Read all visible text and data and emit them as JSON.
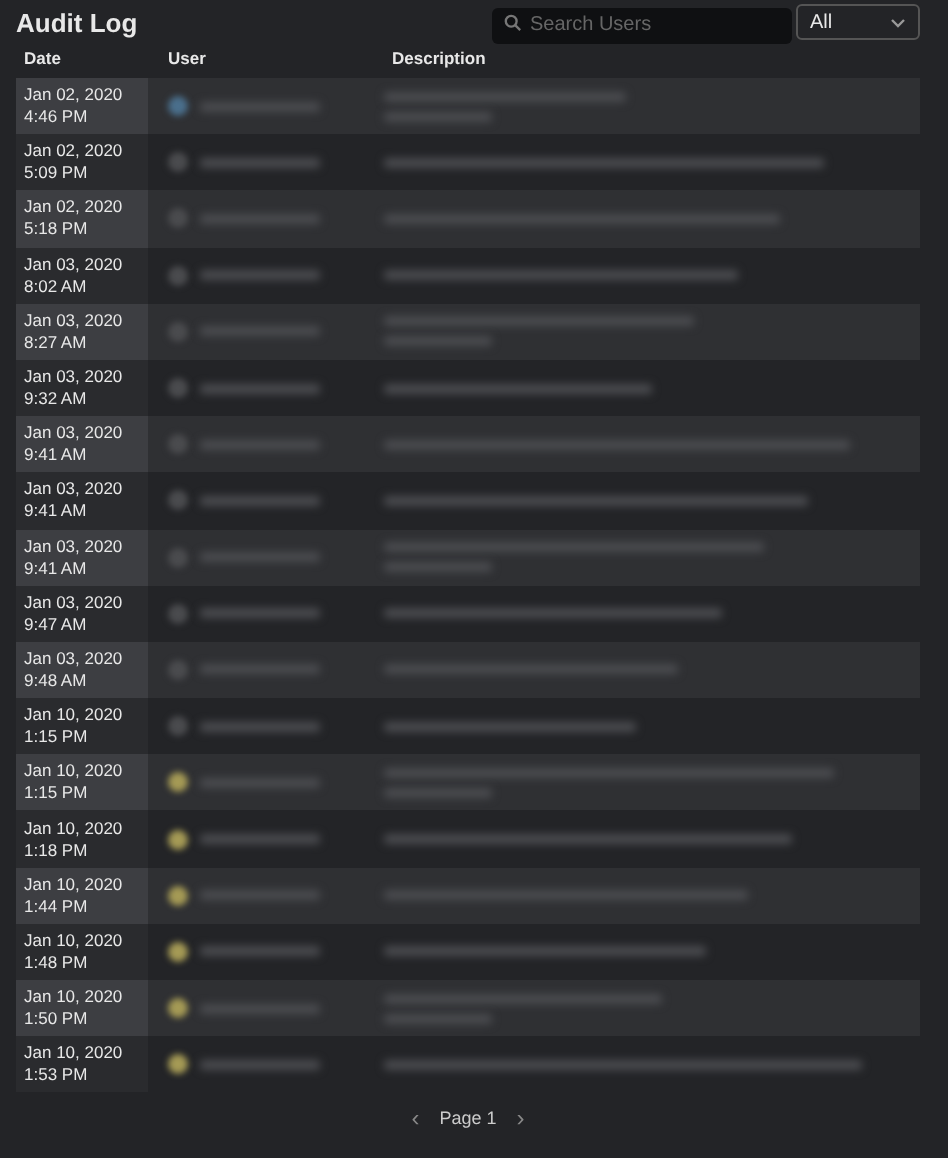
{
  "header": {
    "title": "Audit Log",
    "search": {
      "placeholder": "Search Users"
    },
    "filter": {
      "value": "All"
    }
  },
  "table": {
    "columns": [
      "Date",
      "User",
      "Description"
    ],
    "rows": [
      {
        "date": "Jan 02, 2020",
        "time": "4:46 PM",
        "color": "#4a6f8c"
      },
      {
        "date": "Jan 02, 2020",
        "time": "5:09 PM",
        "color": "#4a4b4e"
      },
      {
        "date": "Jan 02, 2020",
        "time": "5:18 PM",
        "color": "#4a4b4e"
      },
      {
        "date": "Jan 03, 2020",
        "time": "8:02 AM",
        "color": "#4a4b4e"
      },
      {
        "date": "Jan 03, 2020",
        "time": "8:27 AM",
        "color": "#4a4b4e"
      },
      {
        "date": "Jan 03, 2020",
        "time": "9:32 AM",
        "color": "#4a4b4e"
      },
      {
        "date": "Jan 03, 2020",
        "time": "9:41 AM",
        "color": "#4a4b4e"
      },
      {
        "date": "Jan 03, 2020",
        "time": "9:41 AM",
        "color": "#4a4b4e"
      },
      {
        "date": "Jan 03, 2020",
        "time": "9:41 AM",
        "color": "#4a4b4e"
      },
      {
        "date": "Jan 03, 2020",
        "time": "9:47 AM",
        "color": "#4a4b4e"
      },
      {
        "date": "Jan 03, 2020",
        "time": "9:48 AM",
        "color": "#4a4b4e"
      },
      {
        "date": "Jan 10, 2020",
        "time": "1:15 PM",
        "color": "#4a4b4e"
      },
      {
        "date": "Jan 10, 2020",
        "time": "1:15 PM",
        "color": "#a59a55"
      },
      {
        "date": "Jan 10, 2020",
        "time": "1:18 PM",
        "color": "#a59a55"
      },
      {
        "date": "Jan 10, 2020",
        "time": "1:44 PM",
        "color": "#a59a55"
      },
      {
        "date": "Jan 10, 2020",
        "time": "1:48 PM",
        "color": "#a59a55"
      },
      {
        "date": "Jan 10, 2020",
        "time": "1:50 PM",
        "color": "#a59a55"
      },
      {
        "date": "Jan 10, 2020",
        "time": "1:53 PM",
        "color": "#a59a55"
      }
    ]
  },
  "pagination": {
    "prev": "‹",
    "label": "Page 1",
    "next": "›"
  }
}
